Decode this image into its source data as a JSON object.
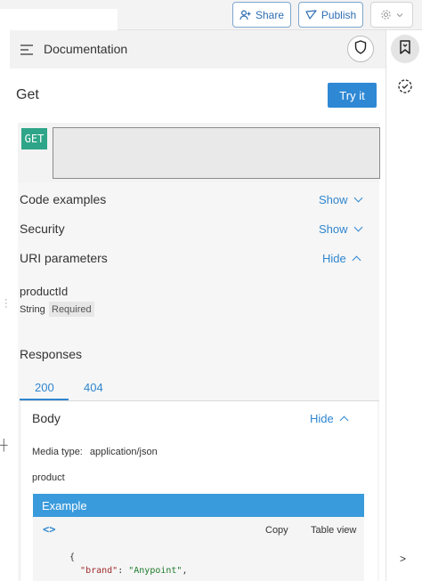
{
  "toolbar": {
    "share_label": "Share",
    "publish_label": "Publish"
  },
  "doc_header": {
    "title": "Documentation"
  },
  "method": {
    "title": "Get",
    "try_label": "Try it",
    "badge": "GET"
  },
  "sections": {
    "code_examples": {
      "label": "Code examples",
      "toggle": "Show"
    },
    "security": {
      "label": "Security",
      "toggle": "Show"
    },
    "uri_parameters": {
      "label": "URI parameters",
      "toggle": "Hide"
    }
  },
  "parameter": {
    "name": "productId",
    "type": "String",
    "required": "Required"
  },
  "responses": {
    "label": "Responses",
    "tabs": [
      "200",
      "404"
    ],
    "body_label": "Body",
    "body_toggle": "Hide",
    "media_label": "Media type:",
    "media_value": "application/json",
    "type_name": "product"
  },
  "example": {
    "header": "Example",
    "copy_label": "Copy",
    "table_label": "Table view",
    "code_open": "{",
    "code_key": "\"brand\"",
    "code_sep": ": ",
    "code_value": "\"Anypoint\"",
    "code_trail": ","
  },
  "icons": {
    "share": "person-add-icon",
    "publish": "publish-icon",
    "gear": "gear-icon",
    "menu": "menu-icon",
    "shield": "shield-icon",
    "bookmark": "bookmark-icon",
    "history": "history-icon",
    "code": "code-icon"
  },
  "colors": {
    "accent": "#2e88d4",
    "get_badge": "#2ea588",
    "example_header": "#3a9bdc"
  }
}
